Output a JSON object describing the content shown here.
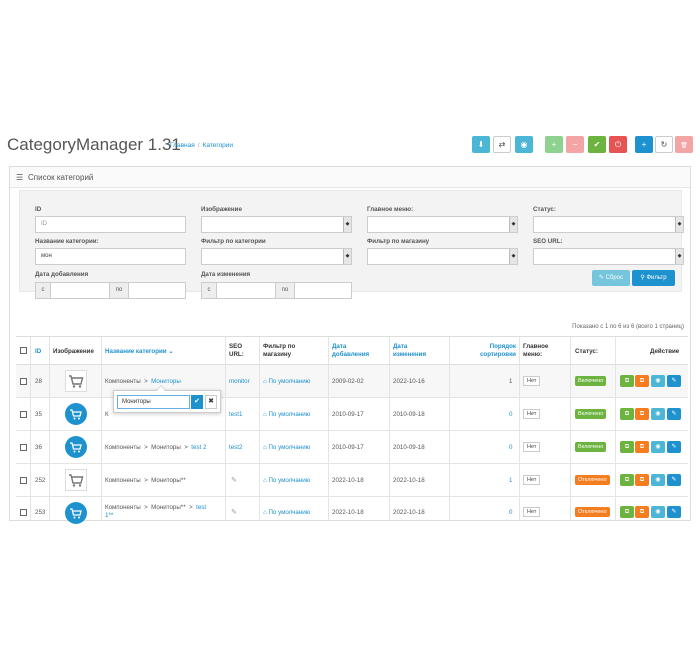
{
  "header": {
    "title": "CategoryManager 1.31",
    "breadcrumb": [
      "Главная",
      "Категории"
    ],
    "breadcrumb_sep": "/"
  },
  "toolbar": {
    "buttons": [
      {
        "icon": "download-icon",
        "glyph": "⬇"
      },
      {
        "icon": "shuffle-icon",
        "glyph": "⇄"
      },
      {
        "icon": "eye-icon",
        "glyph": "◉"
      },
      {
        "icon": "plus-icon",
        "glyph": "+"
      },
      {
        "icon": "minus-icon",
        "glyph": "−"
      },
      {
        "icon": "check-icon",
        "glyph": "✔"
      },
      {
        "icon": "power-icon",
        "glyph": "⏻"
      },
      {
        "icon": "add-icon",
        "glyph": "+"
      },
      {
        "icon": "refresh-icon",
        "glyph": "↻"
      },
      {
        "icon": "trash-icon",
        "glyph": "🗑"
      }
    ]
  },
  "panel": {
    "heading": "Список категорий",
    "heading_icon": "list-icon"
  },
  "filter": {
    "id_label": "ID",
    "id_placeholder": "ID",
    "image_label": "Изображение",
    "main_menu_label": "Главное меню:",
    "status_label": "Статус:",
    "name_label": "Название категории:",
    "name_value": "мон",
    "cat_filter_label": "Фильтр по категории",
    "store_filter_label": "Фильтр по магазину",
    "seo_label": "SEO URL:",
    "date_added_label": "Дата добавления",
    "date_modified_label": "Дата изменения",
    "from": "с",
    "to": "по",
    "reset_label": "Сброс",
    "apply_label": "Фильтр"
  },
  "shown_text": "Показано с 1 по 6 из 6 (всего 1 страниц)",
  "table": {
    "headers": {
      "id": "ID",
      "image": "Изображение",
      "name": "Название категории",
      "seo": "SEO URL:",
      "store": "Фильтр по магазину",
      "date_added": "Дата добавления",
      "date_modified": "Дата изменения",
      "sort": "Порядок сортировки",
      "main_menu": "Главное меню:",
      "status": "Статус:",
      "action": "Действие"
    },
    "rows": [
      {
        "id": "28",
        "path": "Компоненты",
        "leaf": "Мониторы",
        "seo": "monitor",
        "store": "По умолчанию",
        "added": "2009-02-02",
        "modified": "2022-10-16",
        "sort": "1",
        "menu": "Нет",
        "status": "Включено"
      },
      {
        "id": "35",
        "path": "К",
        "leaf": "",
        "seo": "test1",
        "store": "По умолчанию",
        "added": "2010-09-17",
        "modified": "2010-09-18",
        "sort": "0",
        "menu": "Нет",
        "status": "Включено"
      },
      {
        "id": "36",
        "path": "Компоненты",
        "path2": "Мониторы",
        "leaf": "test 2",
        "seo": "test2",
        "store": "По умолчанию",
        "added": "2010-09-17",
        "modified": "2010-09-18",
        "sort": "0",
        "menu": "Нет",
        "status": "Включено"
      },
      {
        "id": "252",
        "path": "Компоненты",
        "leaf": "Мониторы**",
        "seo": "",
        "store": "По умолчанию",
        "added": "2022-10-18",
        "modified": "2022-10-18",
        "sort": "1",
        "menu": "Нет",
        "status": "Отключено"
      },
      {
        "id": "253",
        "path": "Компоненты",
        "path2": "Мониторы**",
        "leaf": "test",
        "leaf2": "1**",
        "seo": "",
        "store": "По умолчанию",
        "added": "2022-10-18",
        "modified": "2022-10-18",
        "sort": "0",
        "menu": "Нет",
        "status": "Отключено"
      }
    ]
  },
  "popover": {
    "value": "Мониторы"
  },
  "colors": {
    "primary": "#1e91cf",
    "info": "#4cb6d6",
    "success": "#6cb33f",
    "danger": "#e55353",
    "warning": "#f57c1f"
  }
}
